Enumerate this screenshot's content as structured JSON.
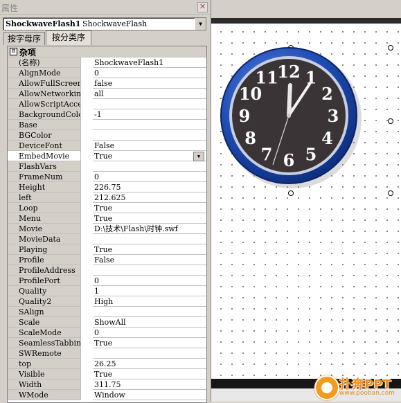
{
  "panel": {
    "title": "属性",
    "close_glyph": "✕",
    "object_name": "ShockwaveFlash1",
    "object_type": "ShockwaveFlash",
    "dropdown_glyph": "▼",
    "tabs": [
      {
        "label": "按字母序"
      },
      {
        "label": "按分类序"
      }
    ],
    "category": {
      "toggle": "⊟",
      "label": "杂项"
    },
    "properties": [
      {
        "name": "(名称)",
        "value": "ShockwaveFlash1"
      },
      {
        "name": "AlignMode",
        "value": "0"
      },
      {
        "name": "AllowFullScreen",
        "value": "false"
      },
      {
        "name": "AllowNetworking",
        "value": "all"
      },
      {
        "name": "AllowScriptAccess",
        "value": ""
      },
      {
        "name": "BackgroundColor",
        "value": "-1"
      },
      {
        "name": "Base",
        "value": ""
      },
      {
        "name": "BGColor",
        "value": ""
      },
      {
        "name": "DeviceFont",
        "value": "False"
      },
      {
        "name": "EmbedMovie",
        "value": "True"
      },
      {
        "name": "FlashVars",
        "value": ""
      },
      {
        "name": "FrameNum",
        "value": "0"
      },
      {
        "name": "Height",
        "value": "226.75"
      },
      {
        "name": "left",
        "value": "212.625"
      },
      {
        "name": "Loop",
        "value": "True"
      },
      {
        "name": "Menu",
        "value": "True"
      },
      {
        "name": "Movie",
        "value": "D:\\技术\\Flash\\时钟.swf"
      },
      {
        "name": "MovieData",
        "value": ""
      },
      {
        "name": "Playing",
        "value": "True"
      },
      {
        "name": "Profile",
        "value": "False"
      },
      {
        "name": "ProfileAddress",
        "value": ""
      },
      {
        "name": "ProfilePort",
        "value": "0"
      },
      {
        "name": "Quality",
        "value": "1"
      },
      {
        "name": "Quality2",
        "value": "High"
      },
      {
        "name": "SAlign",
        "value": ""
      },
      {
        "name": "Scale",
        "value": "ShowAll"
      },
      {
        "name": "ScaleMode",
        "value": "0"
      },
      {
        "name": "SeamlessTabbing",
        "value": "True"
      },
      {
        "name": "SWRemote",
        "value": ""
      },
      {
        "name": "top",
        "value": "26.25"
      },
      {
        "name": "Visible",
        "value": "True"
      },
      {
        "name": "Width",
        "value": "311.75"
      },
      {
        "name": "WMode",
        "value": "Window"
      }
    ],
    "selected_property": "EmbedMovie"
  },
  "clock": {
    "numbers": [
      "12",
      "1",
      "2",
      "3",
      "4",
      "5",
      "6",
      "7",
      "8",
      "9",
      "10",
      "11"
    ],
    "time": {
      "hour": 12,
      "minute": 5,
      "second": 33
    },
    "colors": {
      "rim": "#1e4db3",
      "face": "#3a3436",
      "numerals": "#ffffff"
    }
  },
  "watermark": {
    "brand": "扑奔PPT",
    "url": "www.pooban.com",
    "color": "#f08a14"
  }
}
